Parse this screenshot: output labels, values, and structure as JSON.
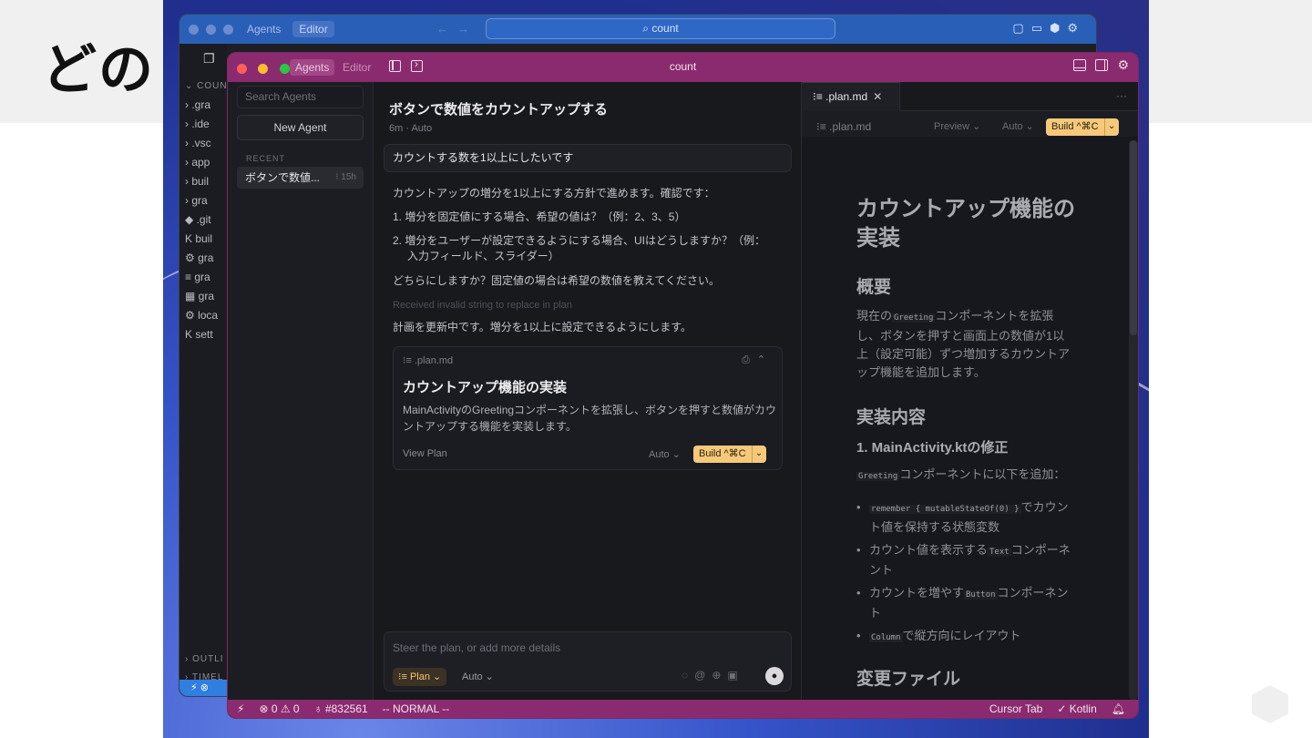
{
  "slide": {
    "title_partial": "どの"
  },
  "back_window": {
    "tabs": [
      "Agents",
      "Editor"
    ],
    "search": "count",
    "tree_header": "COUN",
    "tree_items": [
      "› .gra",
      "› .ide",
      "› .vsc",
      "› app",
      "› buil",
      "› gra",
      "◆ .git",
      "K buil",
      "⚙ gra",
      "≡ gra",
      "▦ gra",
      "⚙ loca",
      "K sett"
    ],
    "bottom_sections": [
      "› OUTLI",
      "› TIMEL"
    ]
  },
  "window": {
    "tab_agents": "Agents",
    "tab_editor": "Editor",
    "title": "count"
  },
  "agents_pane": {
    "search_placeholder": "Search Agents",
    "new_agent": "New Agent",
    "recent_label": "RECENT",
    "recent_item": {
      "title": "ボタンで数値...",
      "meta": "⁝ 15h"
    }
  },
  "chat": {
    "title": "ボタンで数値をカウントアップする",
    "subtitle": "6m · Auto",
    "user_message": "カウントする数を1以上にしたいです",
    "reply_lines": [
      "カウントアップの増分を1以上にする方針で進めます。確認です：",
      "1. 増分を固定値にする場合、希望の値は？（例：2、3、5）",
      "2. 増分をユーザーが設定できるようにする場合、UIはどうしますか？（例：",
      "入力フィールド、スライダー）",
      "どちらにしますか？固定値の場合は希望の数値を教えてください。",
      "Received invalid string to replace in plan",
      "計画を更新中です。増分を1以上に設定できるようにします。"
    ],
    "plan_card": {
      "file": "⁝≡ .plan.md",
      "title": "カウントアップ機能の実装",
      "description": "MainActivityのGreetingコンポーネントを拡張し、ボタンを押すと数値がカウントアップする機能を実装します。",
      "view_plan": "View Plan",
      "auto": "Auto ⌄",
      "build": "Build ^⌘C"
    },
    "composer": {
      "placeholder": "Steer the plan, or add more details",
      "plan_chip": "⁝≡ Plan ⌄",
      "auto": "Auto ⌄"
    }
  },
  "editor": {
    "tab_label": "⁝≡ .plan.md",
    "crumb": "⁝≡  .plan.md",
    "preview": "Preview ⌄",
    "auto": "Auto ⌄",
    "build": "Build ^⌘C",
    "doc": {
      "h1": "カウントアップ機能の実装",
      "h2_overview": "概要",
      "overview_pre": "現在の",
      "overview_code": "Greeting",
      "overview_post": "コンポーネントを拡張し、ボタンを押すと画面上の数値が1以上（設定可能）ずつ増加するカウントアップ機能を追加します。",
      "h2_impl": "実装内容",
      "h3_main": "1. MainActivity.ktの修正",
      "main_code": "Greeting",
      "main_text": "コンポーネントに以下を追加：",
      "bullets": [
        {
          "code": "remember { mutableStateOf(0) }",
          "text": "でカウント値を保持する状態変数"
        },
        {
          "code": "",
          "pre": "カウント値を表示する",
          "code2": "Text",
          "text": "コンポーネント"
        },
        {
          "code": "",
          "pre": "カウントを増やす",
          "code2": "Button",
          "text": "コンポーネント"
        },
        {
          "code": "Column",
          "text": "で縦方向にレイアウト"
        }
      ],
      "h2_files": "変更ファイル"
    }
  },
  "statusbar": {
    "errors": "⊗ 0 ⚠ 0",
    "color": "♁ #832561",
    "mode": "-- NORMAL --",
    "cursor_tab": "Cursor Tab",
    "language": "✓ Kotlin"
  },
  "colors": {
    "accent": "#8b2b6f",
    "build": "#f6c97a",
    "back_accent": "#2a5fb8"
  }
}
